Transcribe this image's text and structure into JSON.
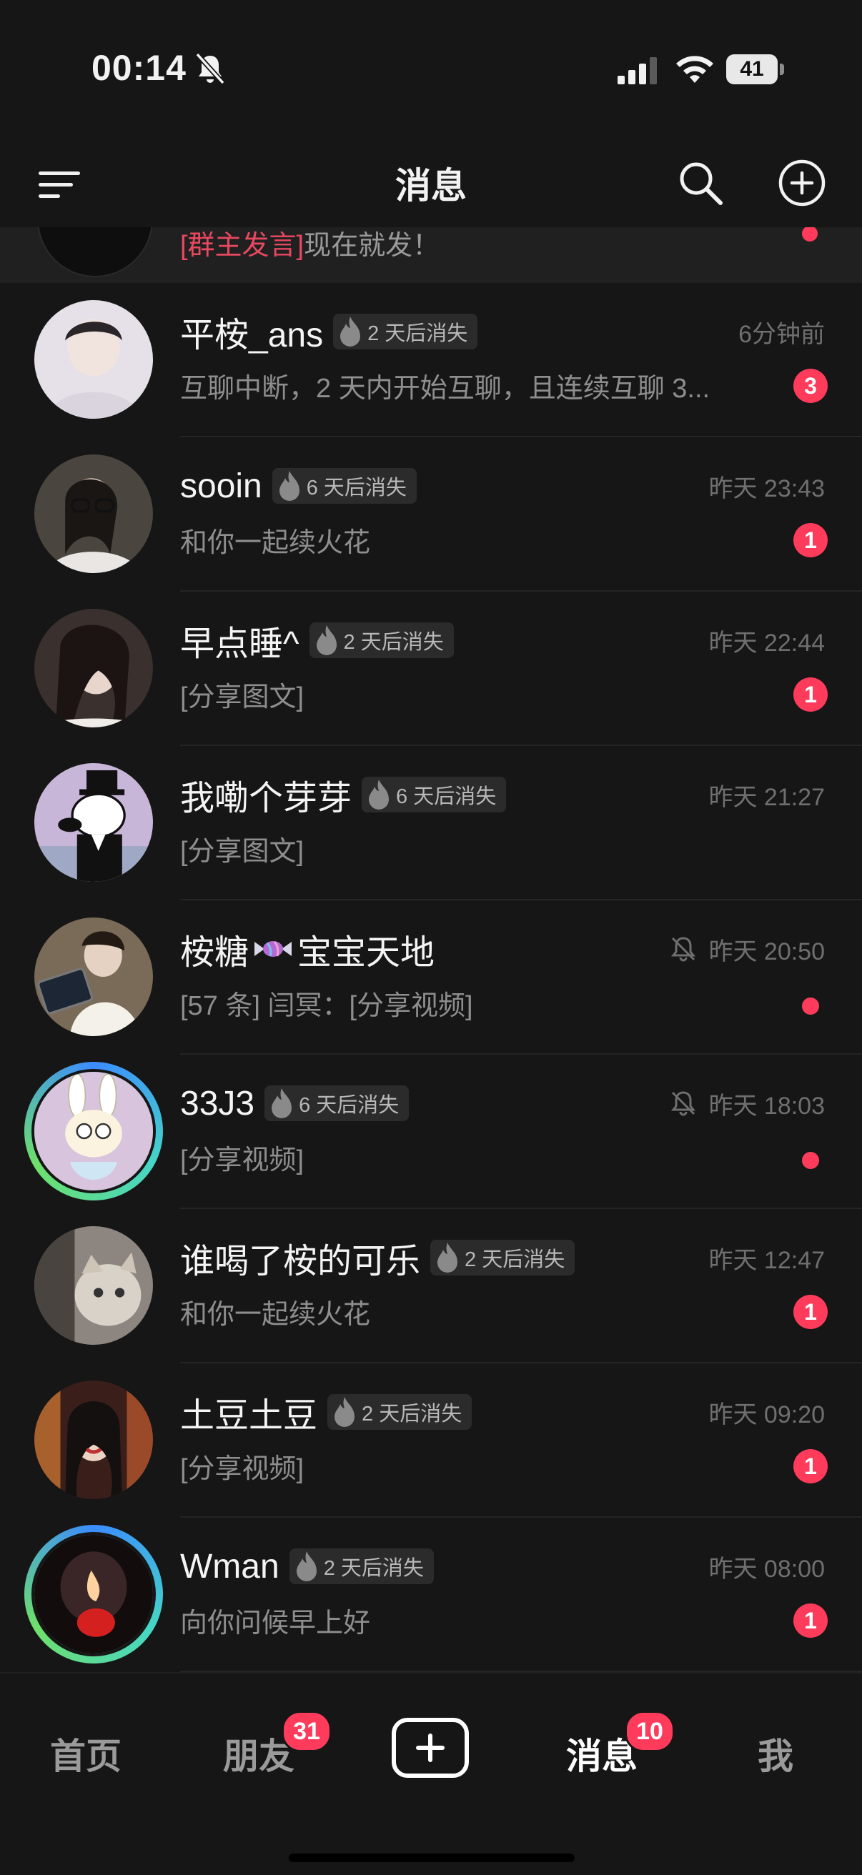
{
  "status_bar": {
    "time": "00:14",
    "battery": "41"
  },
  "header": {
    "title": "消息"
  },
  "pinned_group": {
    "highlight": "[群主发言]",
    "text": "现在就发！"
  },
  "conversations": [
    {
      "name": "平桉_ans",
      "badge": "2 天后消失",
      "time": "6分钟前",
      "preview": "互聊中断，2 天内开始互聊，且连续互聊 3...",
      "unread": "3",
      "muted": false,
      "ring": false,
      "avatar_color": "#d9d2db"
    },
    {
      "name": "sooin",
      "badge": "6 天后消失",
      "time": "昨天 23:43",
      "preview": "和你一起续火花",
      "unread": "1",
      "muted": false,
      "ring": false,
      "avatar_color": "#6b6158"
    },
    {
      "name": "早点睡^",
      "badge": "2 天后消失",
      "time": "昨天 22:44",
      "preview": "[分享图文]",
      "unread": "1",
      "muted": false,
      "ring": false,
      "avatar_color": "#4a3f3b"
    },
    {
      "name": "我嘞个芽芽",
      "badge": "6 天后消失",
      "time": "昨天 21:27",
      "preview": "[分享图文]",
      "unread": "",
      "muted": false,
      "ring": false,
      "avatar_color": "#c9b7d6"
    },
    {
      "name": "桉糖",
      "name_suffix": "宝宝天地",
      "badge": "",
      "time": "昨天 20:50",
      "preview": "[57 条] 闫冥：[分享视频]",
      "unread": "",
      "dot": true,
      "muted": true,
      "ring": false,
      "avatar_color": "#8a7a66"
    },
    {
      "name": "33J3",
      "badge": "6 天后消失",
      "time": "昨天 18:03",
      "preview": "[分享视频]",
      "unread": "",
      "dot": true,
      "muted": true,
      "ring": true,
      "avatar_color": "#d6bfd9"
    },
    {
      "name": "谁喝了桉的可乐",
      "badge": "2 天后消失",
      "time": "昨天 12:47",
      "preview": "和你一起续火花",
      "unread": "1",
      "muted": false,
      "ring": false,
      "avatar_color": "#9c958d"
    },
    {
      "name": "土豆土豆",
      "badge": "2 天后消失",
      "time": "昨天 09:20",
      "preview": "[分享视频]",
      "unread": "1",
      "muted": false,
      "ring": false,
      "avatar_color": "#5a2f2a"
    },
    {
      "name": "Wman",
      "badge": "2 天后消失",
      "time": "昨天 08:00",
      "preview": "向你问候早上好",
      "unread": "1",
      "muted": false,
      "ring": true,
      "avatar_color": "#1c1414"
    }
  ],
  "bottom_nav": {
    "home": "首页",
    "friends": "朋友",
    "friends_badge": "31",
    "messages": "消息",
    "messages_badge": "10",
    "me": "我"
  },
  "colors": {
    "background": "#161616",
    "accent_red": "#ff3b5c",
    "ring_blue": "#3b8cff",
    "ring_green": "#6ee06a"
  },
  "icons": [
    "menu-icon",
    "search-icon",
    "add-circle-icon",
    "flame-icon",
    "bell-off-icon",
    "candy-icon",
    "mute-icon"
  ]
}
